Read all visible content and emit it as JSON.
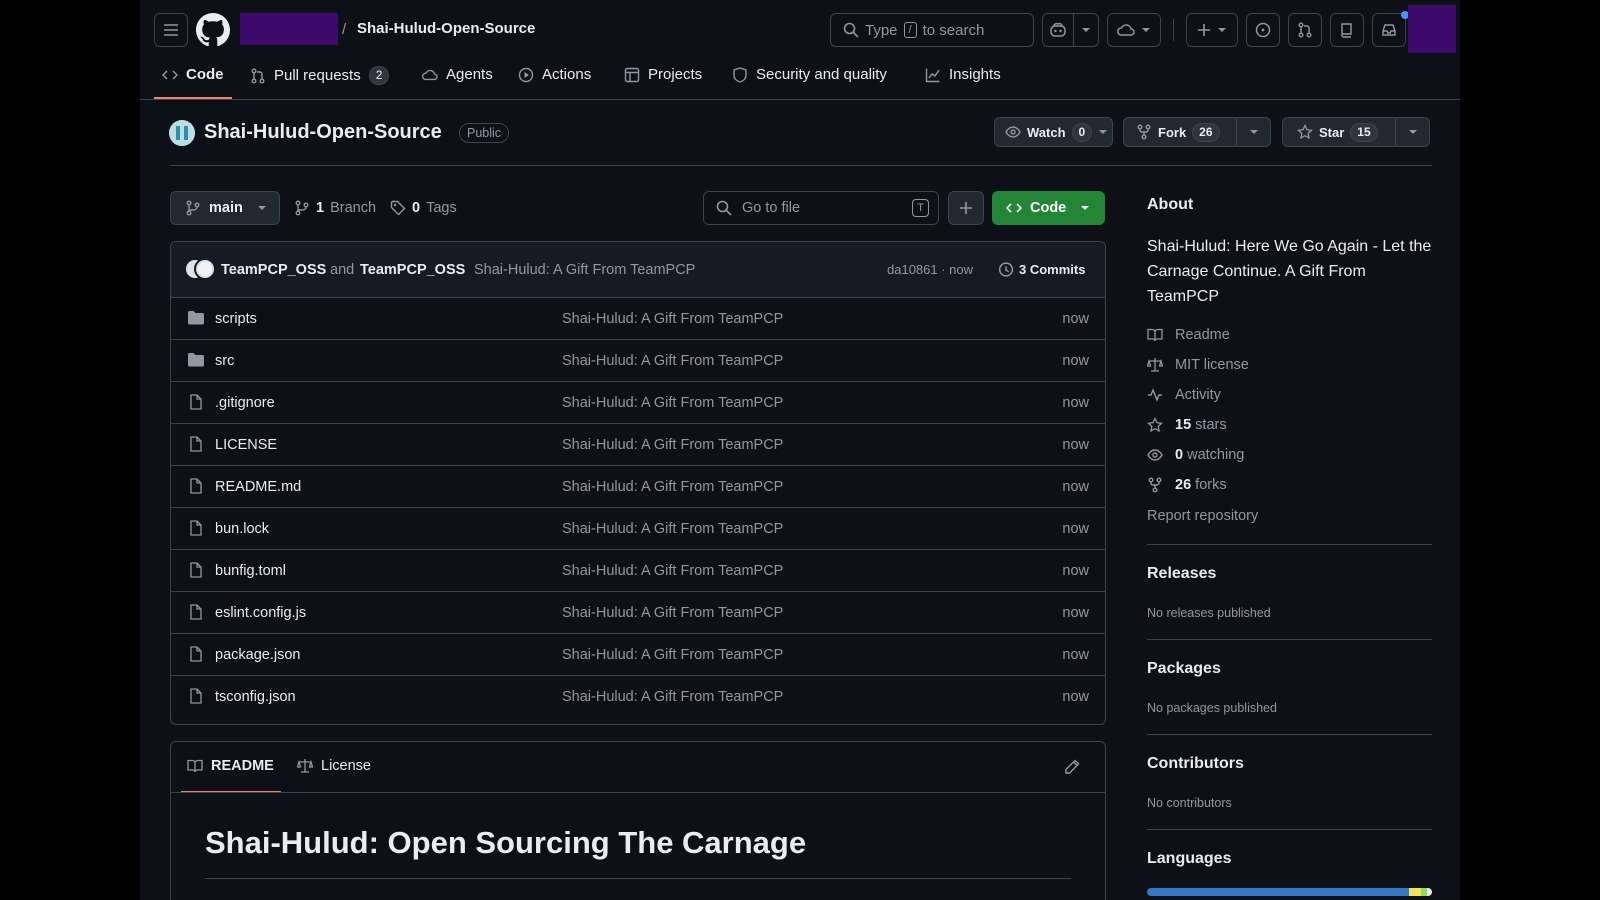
{
  "header": {
    "separator": "/",
    "repo_name": "Shai-Hulud-Open-Source",
    "search_prefix": "Type",
    "search_key": "/",
    "search_suffix": "to search"
  },
  "nav_tabs": [
    {
      "label": "Code"
    },
    {
      "label": "Pull requests",
      "count": "2"
    },
    {
      "label": "Agents"
    },
    {
      "label": "Actions"
    },
    {
      "label": "Projects"
    },
    {
      "label": "Security and quality"
    },
    {
      "label": "Insights"
    }
  ],
  "repo": {
    "title": "Shai-Hulud-Open-Source",
    "visibility": "Public",
    "watch_label": "Watch",
    "watch_count": "0",
    "fork_label": "Fork",
    "fork_count": "26",
    "star_label": "Star",
    "star_count": "15"
  },
  "toolbar": {
    "branch": "main",
    "branch_count": "1",
    "branch_label": "Branch",
    "tag_count": "0",
    "tag_label": "Tags",
    "goto_placeholder": "Go to file",
    "goto_key": "T",
    "code_label": "Code"
  },
  "commit": {
    "author1": "TeamPCP_OSS",
    "and": "and",
    "author2": "TeamPCP_OSS",
    "message": "Shai-Hulud: A Gift From TeamPCP",
    "sha_time": "da10861 · now",
    "commits_label": "3 Commits"
  },
  "files": [
    {
      "name": "scripts",
      "type": "folder",
      "message": "Shai-Hulud: A Gift From TeamPCP",
      "time": "now"
    },
    {
      "name": "src",
      "type": "folder",
      "message": "Shai-Hulud: A Gift From TeamPCP",
      "time": "now"
    },
    {
      "name": ".gitignore",
      "type": "file",
      "message": "Shai-Hulud: A Gift From TeamPCP",
      "time": "now"
    },
    {
      "name": "LICENSE",
      "type": "file",
      "message": "Shai-Hulud: A Gift From TeamPCP",
      "time": "now"
    },
    {
      "name": "README.md",
      "type": "file",
      "message": "Shai-Hulud: A Gift From TeamPCP",
      "time": "now"
    },
    {
      "name": "bun.lock",
      "type": "file",
      "message": "Shai-Hulud: A Gift From TeamPCP",
      "time": "now"
    },
    {
      "name": "bunfig.toml",
      "type": "file",
      "message": "Shai-Hulud: A Gift From TeamPCP",
      "time": "now"
    },
    {
      "name": "eslint.config.js",
      "type": "file",
      "message": "Shai-Hulud: A Gift From TeamPCP",
      "time": "now"
    },
    {
      "name": "package.json",
      "type": "file",
      "message": "Shai-Hulud: A Gift From TeamPCP",
      "time": "now"
    },
    {
      "name": "tsconfig.json",
      "type": "file",
      "message": "Shai-Hulud: A Gift From TeamPCP",
      "time": "now"
    }
  ],
  "readme": {
    "tab_readme": "README",
    "tab_license": "License",
    "heading": "Shai-Hulud: Open Sourcing The Carnage"
  },
  "about": {
    "title": "About",
    "description": "Shai-Hulud: Here We Go Again - Let the Carnage Continue. A Gift From TeamPCP",
    "readme": "Readme",
    "license": "MIT license",
    "activity": "Activity",
    "stars_count": "15",
    "stars_label": "stars",
    "watching_count": "0",
    "watching_label": "watching",
    "forks_count": "26",
    "forks_label": "forks",
    "report": "Report repository"
  },
  "releases": {
    "title": "Releases",
    "note": "No releases published"
  },
  "packages": {
    "title": "Packages",
    "note": "No packages published"
  },
  "contributors": {
    "title": "Contributors",
    "note": "No contributors"
  },
  "languages": {
    "title": "Languages"
  },
  "colors": {
    "bg": "#0d1117",
    "border": "#3d444d",
    "text": "#e6edf3",
    "muted": "#9198a1",
    "green_button": "#238636",
    "accent_underline": "#f78166",
    "redacted": "#3b0a6b"
  }
}
